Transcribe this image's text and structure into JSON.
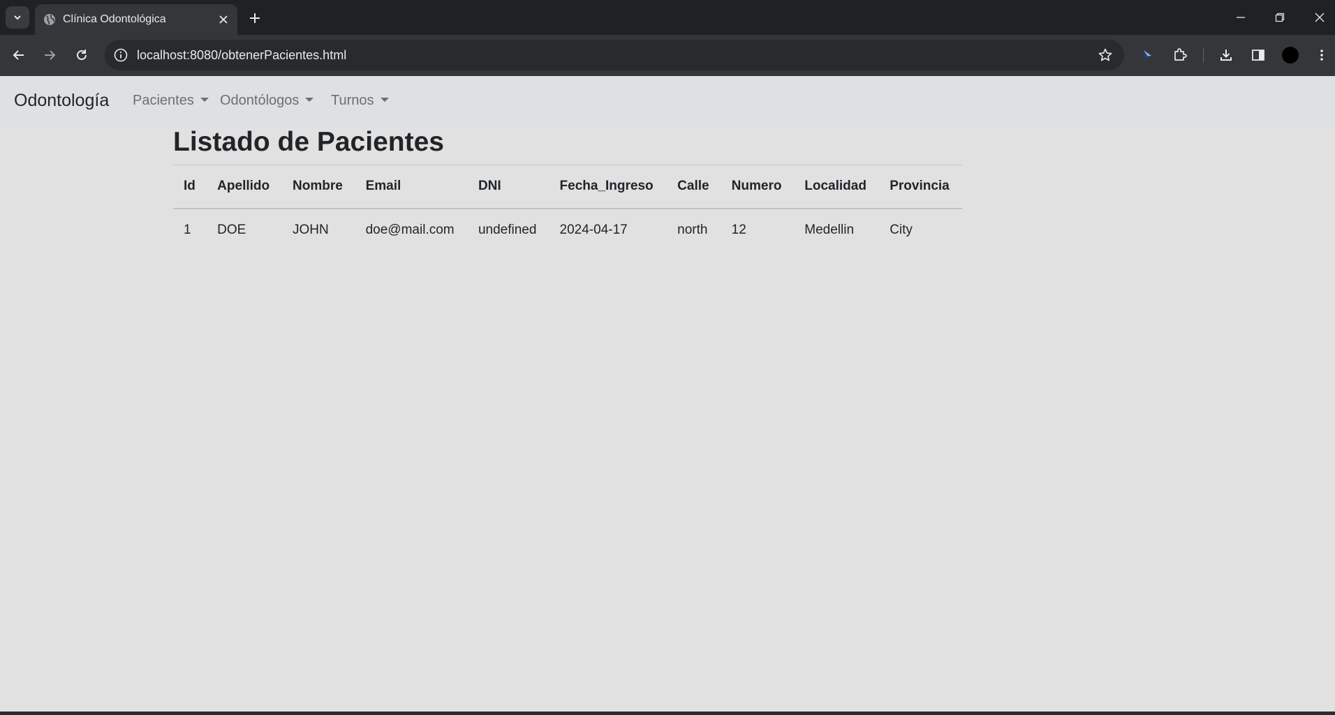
{
  "browser": {
    "tab_title": "Clínica Odontológica",
    "url": "localhost:8080/obtenerPacientes.html"
  },
  "navbar": {
    "brand": "Odontología",
    "menus": [
      "Pacientes",
      "Odontólogos",
      "Turnos"
    ]
  },
  "main": {
    "title": "Listado de Pacientes",
    "table": {
      "headers": [
        "Id",
        "Apellido",
        "Nombre",
        "Email",
        "DNI",
        "Fecha_Ingreso",
        "Calle",
        "Numero",
        "Localidad",
        "Provincia"
      ],
      "rows": [
        [
          "1",
          "DOE",
          "JOHN",
          "doe@mail.com",
          "undefined",
          "2024-04-17",
          "north",
          "12",
          "Medellin",
          "City"
        ]
      ]
    }
  }
}
